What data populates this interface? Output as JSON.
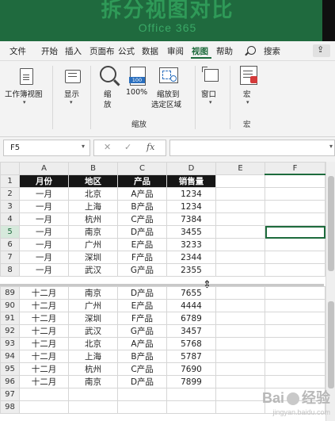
{
  "banner": {
    "title": "拆分视图对比",
    "subtitle": "Office 365"
  },
  "menubar": {
    "tabs": [
      "文件",
      "开始",
      "插入",
      "页面布",
      "公式",
      "数据",
      "审阅",
      "视图",
      "帮助"
    ],
    "active": "视图",
    "search_label": "搜索"
  },
  "ribbon": {
    "workbook_view": "工作簿视图",
    "display": "显示",
    "zoom": {
      "label1": "缩",
      "label2": "放"
    },
    "zoom100": "100%",
    "zoom_to_selection": {
      "line1": "缩放到",
      "line2": "选定区域"
    },
    "zoom_group": "缩放",
    "window": "窗口",
    "macro": "宏",
    "macro_group": "宏"
  },
  "formula_bar": {
    "name_box": "F5",
    "cancel": "✕",
    "enter": "✓",
    "fx": "fx",
    "value": ""
  },
  "sheet": {
    "columns": [
      "A",
      "B",
      "C",
      "D",
      "E",
      "F"
    ],
    "selected_column": "F",
    "selected_row": "5",
    "header": [
      "月份",
      "地区",
      "产品",
      "销售量"
    ],
    "top_rows": [
      {
        "n": "2",
        "cells": [
          "一月",
          "北京",
          "A产品",
          "1234"
        ]
      },
      {
        "n": "3",
        "cells": [
          "一月",
          "上海",
          "B产品",
          "1234"
        ]
      },
      {
        "n": "4",
        "cells": [
          "一月",
          "杭州",
          "C产品",
          "7384"
        ]
      },
      {
        "n": "5",
        "cells": [
          "一月",
          "南京",
          "D产品",
          "3455"
        ]
      },
      {
        "n": "6",
        "cells": [
          "一月",
          "广州",
          "E产品",
          "3233"
        ]
      },
      {
        "n": "7",
        "cells": [
          "一月",
          "深圳",
          "F产品",
          "2344"
        ]
      },
      {
        "n": "8",
        "cells": [
          "一月",
          "武汉",
          "G产品",
          "2355"
        ]
      }
    ],
    "bottom_rows": [
      {
        "n": "89",
        "cells": [
          "十二月",
          "南京",
          "D产品",
          "7655"
        ]
      },
      {
        "n": "90",
        "cells": [
          "十二月",
          "广州",
          "E产品",
          "4444"
        ]
      },
      {
        "n": "91",
        "cells": [
          "十二月",
          "深圳",
          "F产品",
          "6789"
        ]
      },
      {
        "n": "92",
        "cells": [
          "十二月",
          "武汉",
          "G产品",
          "3457"
        ]
      },
      {
        "n": "93",
        "cells": [
          "十二月",
          "北京",
          "A产品",
          "5768"
        ]
      },
      {
        "n": "94",
        "cells": [
          "十二月",
          "上海",
          "B产品",
          "5787"
        ]
      },
      {
        "n": "95",
        "cells": [
          "十二月",
          "杭州",
          "C产品",
          "7690"
        ]
      },
      {
        "n": "96",
        "cells": [
          "十二月",
          "南京",
          "D产品",
          "7899"
        ]
      },
      {
        "n": "97",
        "cells": [
          "",
          "",
          "",
          ""
        ]
      },
      {
        "n": "98",
        "cells": [
          "",
          "",
          "",
          ""
        ]
      }
    ]
  },
  "watermark": {
    "brand": "Bai",
    "brand2": "经验",
    "url": "jingyan.baidu.com"
  }
}
